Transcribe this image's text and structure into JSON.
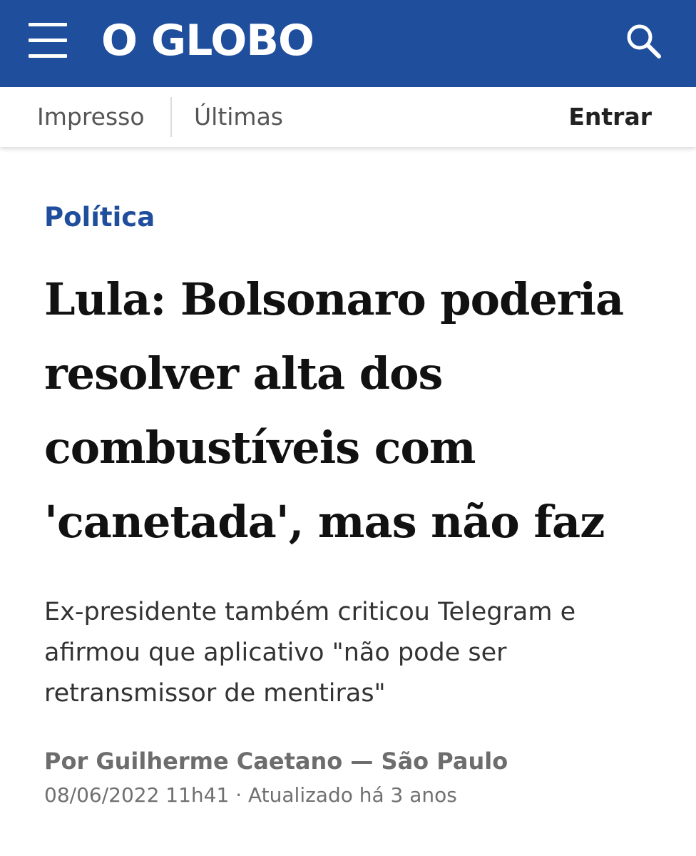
{
  "header": {
    "logo_text": "O GLOBO",
    "menu_icon": "hamburger-menu-icon",
    "search_icon": "search-icon",
    "background_color": "#1f4e9c"
  },
  "subnav": {
    "impresso": "Impresso",
    "ultimas": "Últimas",
    "entrar": "Entrar"
  },
  "article": {
    "section": "Política",
    "headline": "Lula: Bolsonaro poderia resolver alta dos combustíveis com 'canetada', mas não faz",
    "subtitle": "Ex-presidente também criticou Telegram e afirmou que aplicativo \"não pode ser retransmissor de mentiras\"",
    "byline": "Por Guilherme Caetano — São Paulo",
    "dateline": "08/06/2022 11h41 · Atualizado há 3 anos",
    "accent_color": "#1f4e9c"
  }
}
